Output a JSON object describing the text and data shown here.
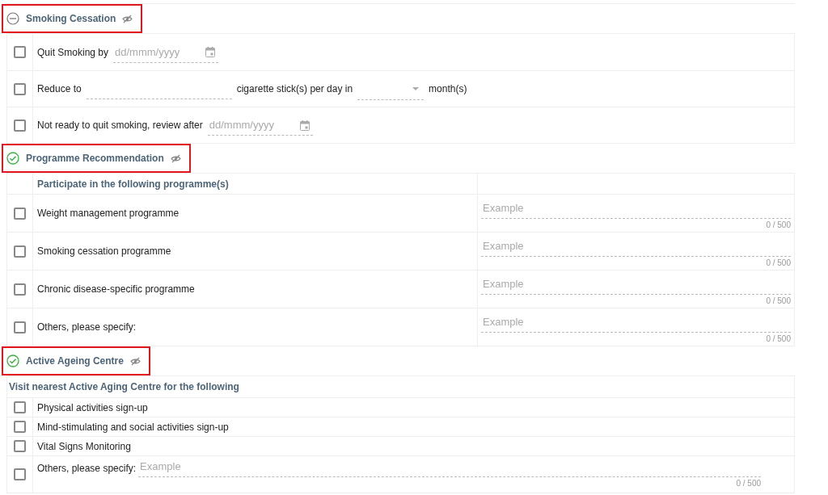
{
  "sections": [
    {
      "title": "Smoking Cessation",
      "complete": false,
      "highlighted": true,
      "kind": "options",
      "rows": [
        {
          "kind": "date",
          "checked": false,
          "label": "Quit Smoking by",
          "placeholder": "dd/mmm/yyyy"
        },
        {
          "kind": "reduce",
          "checked": false,
          "label": "Reduce to",
          "middle_label": "cigarette stick(s) per day in",
          "end_label": "month(s)"
        },
        {
          "kind": "date",
          "checked": false,
          "label": "Not ready to quit smoking, review after",
          "placeholder": "dd/mmm/yyyy"
        }
      ]
    },
    {
      "title": "Programme Recommendation",
      "complete": true,
      "highlighted": true,
      "kind": "table",
      "heading": "Participate in the following programme(s)",
      "rows": [
        {
          "checked": false,
          "label": "Weight management programme",
          "placeholder": "Example",
          "counter": "0 / 500"
        },
        {
          "checked": false,
          "label": "Smoking cessation programme",
          "placeholder": "Example",
          "counter": "0 / 500"
        },
        {
          "checked": false,
          "label": "Chronic disease-specific programme",
          "placeholder": "Example",
          "counter": "0 / 500"
        },
        {
          "checked": false,
          "label": "Others, please specify:",
          "placeholder": "Example",
          "counter": "0 / 500"
        }
      ]
    },
    {
      "title": "Active Ageing Centre",
      "complete": true,
      "highlighted": true,
      "kind": "list",
      "heading": "Visit nearest Active Aging Centre for the following",
      "rows": [
        {
          "kind": "plain",
          "checked": false,
          "label": "Physical activities sign-up"
        },
        {
          "kind": "plain",
          "checked": false,
          "label": "Mind-stimulating and social activities sign-up"
        },
        {
          "kind": "plain",
          "checked": false,
          "label": "Vital Signs Monitoring"
        },
        {
          "kind": "specify",
          "checked": false,
          "label": "Others, please specify:",
          "placeholder": "Example",
          "counter": "0 / 500"
        }
      ]
    }
  ]
}
